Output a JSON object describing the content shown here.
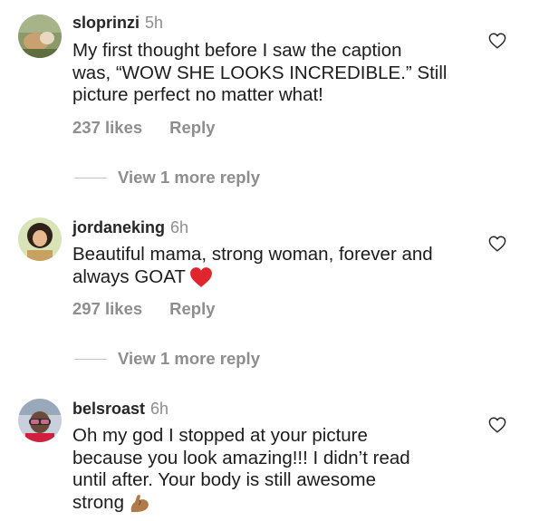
{
  "comments": [
    {
      "username": "sloprinzi",
      "time": "5h",
      "text_lines": [
        "My first thought before I saw the caption",
        "was, “WOW SHE LOOKS INCREDIBLE.” Still",
        "picture perfect no matter what!"
      ],
      "likes": "237 likes",
      "reply_label": "Reply",
      "view_more": "View 1 more reply"
    },
    {
      "username": "jordaneking",
      "time": "6h",
      "text_lines": [
        "Beautiful mama, strong woman, forever and",
        "always GOAT"
      ],
      "emoji": "red-heart-emoji",
      "likes": "297 likes",
      "reply_label": "Reply",
      "view_more": "View 1 more reply"
    },
    {
      "username": "belsroast",
      "time": "6h",
      "text_lines": [
        "Oh my god I stopped at your picture",
        "because you look amazing!!! I didn’t read",
        "until after.  Your body is still awesome",
        "strong"
      ],
      "emoji": "flexed-biceps-emoji"
    }
  ],
  "colors": {
    "username": "#262626",
    "secondary": "#8e8e8e",
    "heart_emoji": "#e0262d",
    "divider": "#c7c7c7"
  },
  "icons": [
    "like-heart-outline-icon"
  ]
}
